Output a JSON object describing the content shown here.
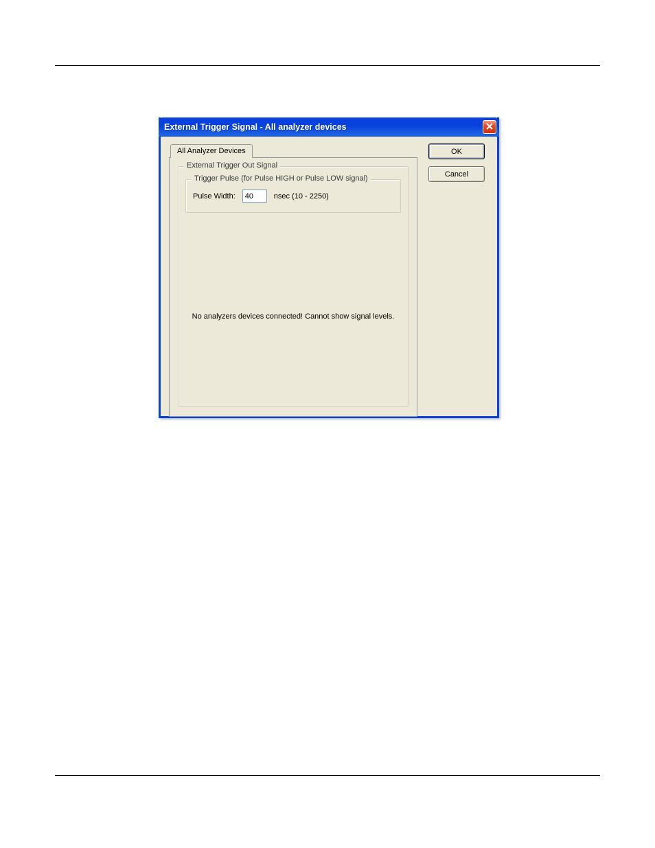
{
  "dialog": {
    "title": "External Trigger Signal - All analyzer devices",
    "close_icon_name": "close-icon",
    "tab_label": "All Analyzer Devices",
    "outer_group_label": "External Trigger Out Signal",
    "inner_group_label": "Trigger Pulse (for Pulse HIGH or Pulse LOW signal)",
    "pulse_width_label": "Pulse Width:",
    "pulse_width_value": "40",
    "pulse_width_units": "nsec (10 - 2250)",
    "status_message": "No analyzers devices connected! Cannot show signal levels.",
    "ok_label": "OK",
    "cancel_label": "Cancel"
  }
}
